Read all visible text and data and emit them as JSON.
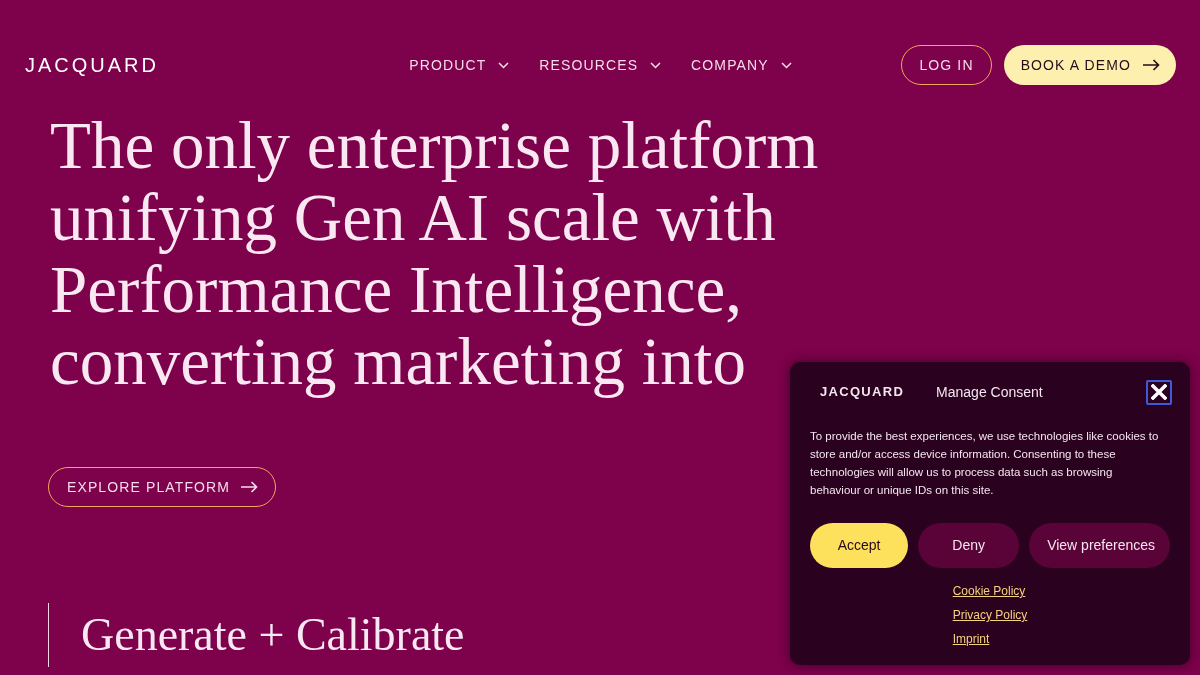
{
  "header": {
    "logo": "JACQUARD",
    "nav": [
      {
        "label": "PRODUCT",
        "dropdown": true
      },
      {
        "label": "RESOURCES",
        "dropdown": true
      },
      {
        "label": "COMPANY",
        "dropdown": true
      }
    ],
    "login": "LOG IN",
    "demo": "BOOK A DEMO"
  },
  "hero": {
    "headline_lines": [
      "The only enterprise platform",
      "unifying Gen AI scale with",
      "Performance Intelligence,",
      "converting marketing into"
    ],
    "cta": "EXPLORE PLATFORM"
  },
  "section": {
    "title": "Generate + Calibrate"
  },
  "consent": {
    "brand": "JACQUARD",
    "title": "Manage Consent",
    "body": "To provide the best experiences, we use technologies like cookies to store and/or access device information. Consenting to these technologies will allow us to process data such as browsing behaviour or unique IDs on this site.",
    "buttons": [
      {
        "label": "Accept",
        "kind": "primary"
      },
      {
        "label": "Deny",
        "kind": "secondary"
      },
      {
        "label": "View preferences",
        "kind": "secondary"
      }
    ],
    "links": [
      "Cookie Policy",
      "Privacy Policy",
      "Imprint"
    ]
  }
}
